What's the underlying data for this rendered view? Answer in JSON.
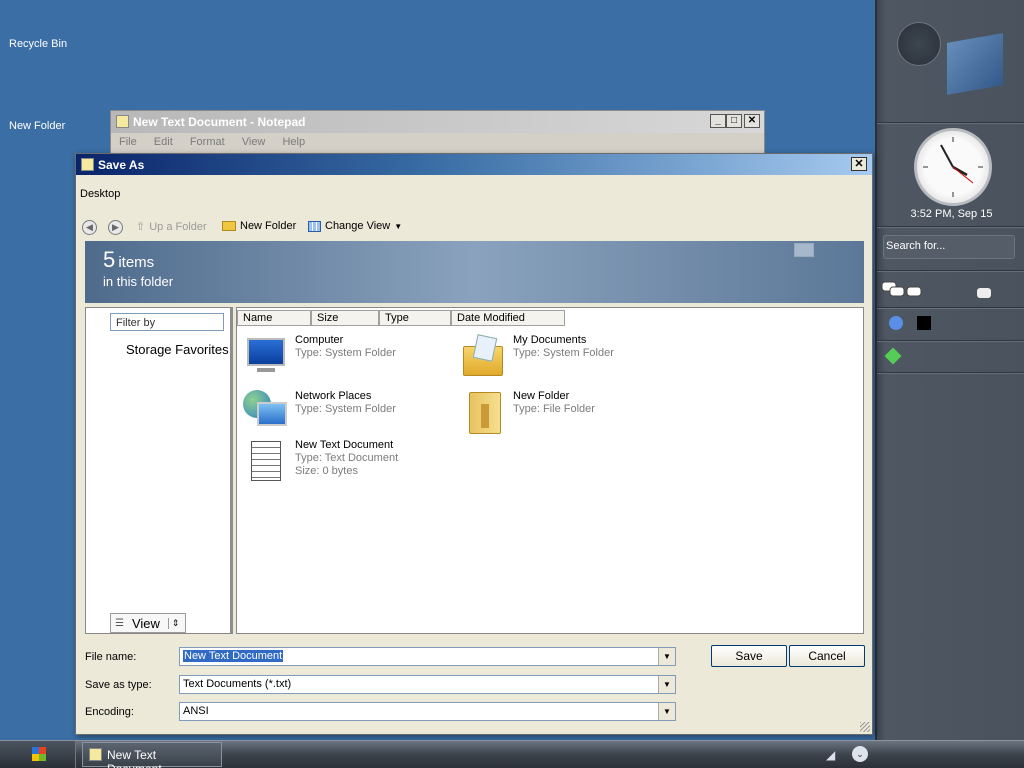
{
  "desktop": {
    "icons": [
      {
        "label": "Recycle Bin"
      },
      {
        "label": "New Folder"
      }
    ]
  },
  "sidebar": {
    "clock": {
      "time": "3:52 PM, Sep 15"
    },
    "search": {
      "placeholder": "Search for..."
    }
  },
  "notepad": {
    "title": "New Text Document - Notepad",
    "menu": [
      "File",
      "Edit",
      "Format",
      "View",
      "Help"
    ]
  },
  "save_as": {
    "title": "Save As",
    "location": "Desktop",
    "toolbar": {
      "up_folder": "Up a Folder",
      "new_folder": "New Folder",
      "change_view": "Change View"
    },
    "banner": {
      "count": "5",
      "items_word": "items",
      "subtitle": "in this folder"
    },
    "left_pane": {
      "filter_placeholder": "Filter by",
      "storage_favorites": "Storage Favorites",
      "view_label": "View"
    },
    "columns": [
      "Name",
      "Size",
      "Type",
      "Date Modified"
    ],
    "files": [
      {
        "name": "Computer",
        "line2": "Type: System Folder",
        "line3": "",
        "icon": "computer-icon"
      },
      {
        "name": "My Documents",
        "line2": "Type: System Folder",
        "line3": "",
        "icon": "my-documents-icon"
      },
      {
        "name": "Network Places",
        "line2": "Type: System Folder",
        "line3": "",
        "icon": "network-places-icon"
      },
      {
        "name": "New Folder",
        "line2": "Type: File Folder",
        "line3": "",
        "icon": "folder-icon"
      },
      {
        "name": "New Text Document",
        "line2": "Type: Text Document",
        "line3": "Size: 0 bytes",
        "icon": "text-document-icon"
      }
    ],
    "fields": {
      "file_name_label": "File name:",
      "file_name_value": "New Text Document",
      "save_as_type_label": "Save as type:",
      "save_as_type_value": "Text Documents (*.txt)",
      "encoding_label": "Encoding:",
      "encoding_value": "ANSI"
    },
    "buttons": {
      "save": "Save",
      "cancel": "Cancel"
    }
  },
  "taskbar": {
    "task_label": "New Text Document..."
  },
  "colors": {
    "desktop": "#3a6ea5",
    "title_active": "#0a246a",
    "dialog_bg": "#ece9d8",
    "taskbar": "#3c434c"
  }
}
